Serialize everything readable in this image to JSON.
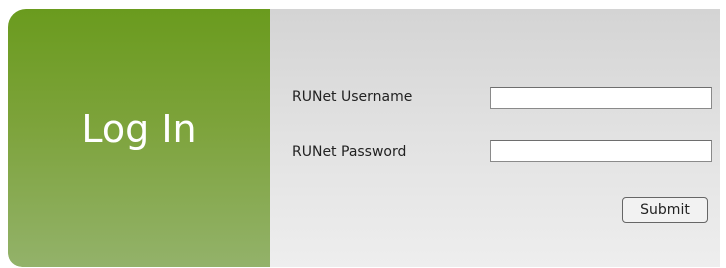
{
  "login": {
    "title": "Log In",
    "username_label": "RUNet Username",
    "username_value": "",
    "password_label": "RUNet Password",
    "password_value": "",
    "submit_label": "Submit"
  },
  "colors": {
    "panel_green": "#6a9b1e",
    "panel_gray": "#dcdcdc"
  }
}
